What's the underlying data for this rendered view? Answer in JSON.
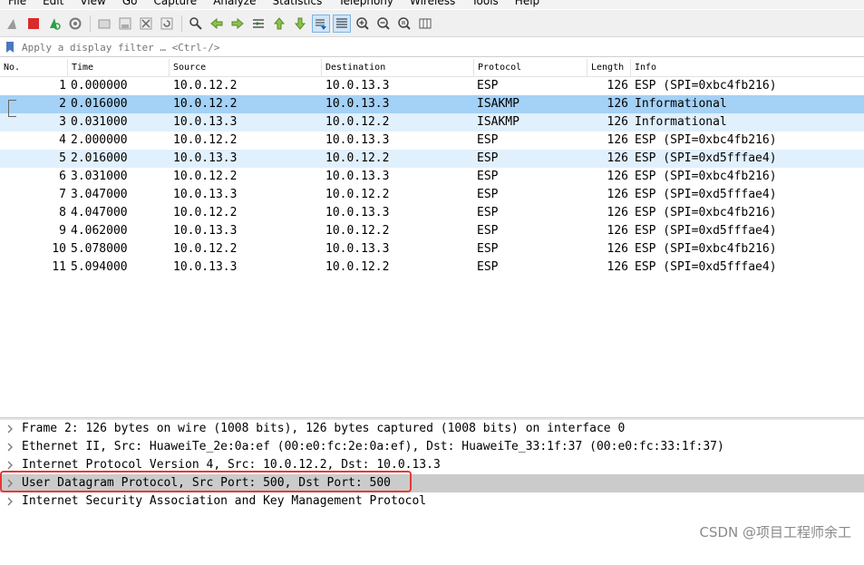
{
  "menu": [
    "File",
    "Edit",
    "View",
    "Go",
    "Capture",
    "Analyze",
    "Statistics",
    "Telephony",
    "Wireless",
    "Tools",
    "Help"
  ],
  "toolbar": {
    "icons": [
      "shark-fin-icon",
      "stop-capture-icon",
      "restart-capture-icon",
      "capture-options-icon",
      "open-file-icon",
      "save-file-icon",
      "close-file-icon",
      "reload-file-icon",
      "find-packet-icon",
      "go-back-icon",
      "go-forward-icon",
      "go-to-packet-icon",
      "go-first-icon",
      "go-last-icon",
      "autoscroll-icon",
      "colorize-icon",
      "zoom-in-icon",
      "zoom-out-icon",
      "zoom-normal-icon",
      "resize-columns-icon"
    ]
  },
  "filter": {
    "placeholder": "Apply a display filter … <Ctrl-/>"
  },
  "columns": {
    "no": "No.",
    "time": "Time",
    "source": "Source",
    "destination": "Destination",
    "protocol": "Protocol",
    "length": "Length",
    "info": "Info"
  },
  "packets": [
    {
      "no": "1",
      "time": "0.000000",
      "source": "10.0.12.2",
      "destination": "10.0.13.3",
      "protocol": "ESP",
      "length": "126",
      "info": "ESP (SPI=0xbc4fb216)"
    },
    {
      "no": "2",
      "time": "0.016000",
      "source": "10.0.12.2",
      "destination": "10.0.13.3",
      "protocol": "ISAKMP",
      "length": "126",
      "info": "Informational"
    },
    {
      "no": "3",
      "time": "0.031000",
      "source": "10.0.13.3",
      "destination": "10.0.12.2",
      "protocol": "ISAKMP",
      "length": "126",
      "info": "Informational"
    },
    {
      "no": "4",
      "time": "2.000000",
      "source": "10.0.12.2",
      "destination": "10.0.13.3",
      "protocol": "ESP",
      "length": "126",
      "info": "ESP (SPI=0xbc4fb216)"
    },
    {
      "no": "5",
      "time": "2.016000",
      "source": "10.0.13.3",
      "destination": "10.0.12.2",
      "protocol": "ESP",
      "length": "126",
      "info": "ESP (SPI=0xd5fffae4)"
    },
    {
      "no": "6",
      "time": "3.031000",
      "source": "10.0.12.2",
      "destination": "10.0.13.3",
      "protocol": "ESP",
      "length": "126",
      "info": "ESP (SPI=0xbc4fb216)"
    },
    {
      "no": "7",
      "time": "3.047000",
      "source": "10.0.13.3",
      "destination": "10.0.12.2",
      "protocol": "ESP",
      "length": "126",
      "info": "ESP (SPI=0xd5fffae4)"
    },
    {
      "no": "8",
      "time": "4.047000",
      "source": "10.0.12.2",
      "destination": "10.0.13.3",
      "protocol": "ESP",
      "length": "126",
      "info": "ESP (SPI=0xbc4fb216)"
    },
    {
      "no": "9",
      "time": "4.062000",
      "source": "10.0.13.3",
      "destination": "10.0.12.2",
      "protocol": "ESP",
      "length": "126",
      "info": "ESP (SPI=0xd5fffae4)"
    },
    {
      "no": "10",
      "time": "5.078000",
      "source": "10.0.12.2",
      "destination": "10.0.13.3",
      "protocol": "ESP",
      "length": "126",
      "info": "ESP (SPI=0xbc4fb216)"
    },
    {
      "no": "11",
      "time": "5.094000",
      "source": "10.0.13.3",
      "destination": "10.0.12.2",
      "protocol": "ESP",
      "length": "126",
      "info": "ESP (SPI=0xd5fffae4)"
    }
  ],
  "details": [
    "Frame 2: 126 bytes on wire (1008 bits), 126 bytes captured (1008 bits) on interface 0",
    "Ethernet II, Src: HuaweiTe_2e:0a:ef (00:e0:fc:2e:0a:ef), Dst: HuaweiTe_33:1f:37 (00:e0:fc:33:1f:37)",
    "Internet Protocol Version 4, Src: 10.0.12.2, Dst: 10.0.13.3",
    "User Datagram Protocol, Src Port: 500, Dst Port: 500",
    "Internet Security Association and Key Management Protocol"
  ],
  "watermark": "CSDN @项目工程师余工",
  "colors": {
    "selected_row": "#a4d1f6",
    "related_row": "#e1f0fd",
    "highlight_box": "#e53935",
    "detail_selected": "#cbcbcb"
  }
}
